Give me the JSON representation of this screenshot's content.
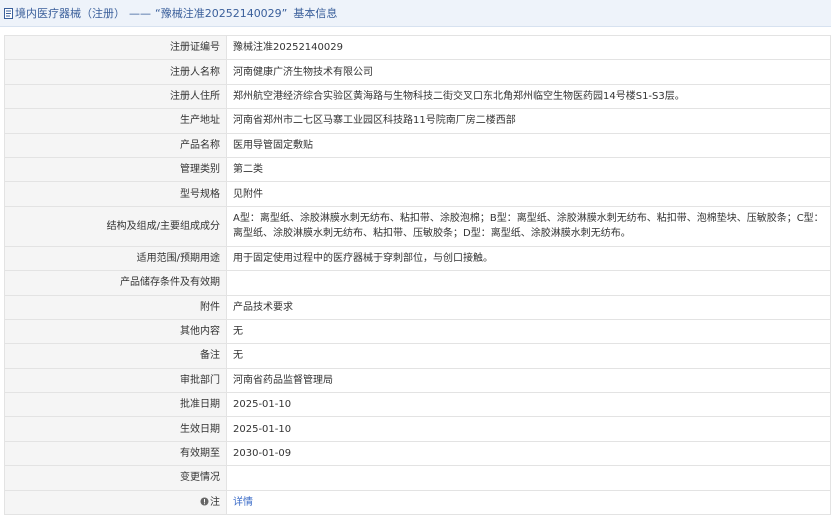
{
  "header": {
    "category": "境内医疗器械（注册）",
    "separator": "——",
    "cert_title": "“豫械注准20252140029”",
    "section": "基本信息"
  },
  "rows": [
    {
      "label": "注册证编号",
      "value": "豫械注准20252140029"
    },
    {
      "label": "注册人名称",
      "value": "河南健康广济生物技术有限公司"
    },
    {
      "label": "注册人住所",
      "value": "郑州航空港经济综合实验区黄海路与生物科技二街交叉口东北角郑州临空生物医药园14号楼S1-S3层。"
    },
    {
      "label": "生产地址",
      "value": "河南省郑州市二七区马寨工业园区科技路11号院南厂房二楼西部"
    },
    {
      "label": "产品名称",
      "value": "医用导管固定敷贴"
    },
    {
      "label": "管理类别",
      "value": "第二类"
    },
    {
      "label": "型号规格",
      "value": "见附件"
    },
    {
      "label": "结构及组成/主要组成成分",
      "value": "A型：离型纸、涂胶淋膜水刺无纺布、粘扣带、涂胶泡棉；B型：离型纸、涂胶淋膜水刺无纺布、粘扣带、泡棉垫块、压敏胶条；C型：离型纸、涂胶淋膜水刺无纺布、粘扣带、压敏胶条；D型：离型纸、涂胶淋膜水刺无纺布。"
    },
    {
      "label": "适用范围/预期用途",
      "value": "用于固定使用过程中的医疗器械于穿刺部位，与创口接触。"
    },
    {
      "label": "产品储存条件及有效期",
      "value": ""
    },
    {
      "label": "附件",
      "value": "产品技术要求"
    },
    {
      "label": "其他内容",
      "value": "无"
    },
    {
      "label": "备注",
      "value": "无"
    },
    {
      "label": "审批部门",
      "value": "河南省药品监督管理局"
    },
    {
      "label": "批准日期",
      "value": "2025-01-10"
    },
    {
      "label": "生效日期",
      "value": "2025-01-10"
    },
    {
      "label": "有效期至",
      "value": "2030-01-09"
    },
    {
      "label": "变更情况",
      "value": ""
    }
  ],
  "note_row": {
    "label": "注",
    "link": "详情"
  },
  "icons": {
    "header": "document-icon",
    "note": "note-icon"
  },
  "colors": {
    "header_text": "#3a5f9b",
    "link": "#3a6bc7",
    "label_bg": "#f5f5f5",
    "header_bg": "#eef3fa"
  }
}
